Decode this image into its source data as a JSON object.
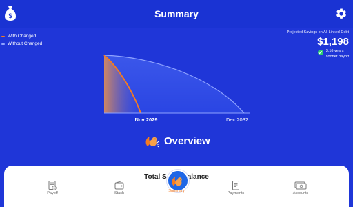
{
  "header": {
    "title": "Summary",
    "app_icon": "money-bag-icon",
    "settings_icon": "gear-icon"
  },
  "legend": [
    {
      "label": "With Changed",
      "color": "#f47b20"
    },
    {
      "label": "Without Changed",
      "color": "#8fa3ff"
    }
  ],
  "savings": {
    "label": "Projected Savings on All Linked Debt",
    "amount": "$1,198",
    "sooner_line1": "3.16 years",
    "sooner_line2": "sooner payoff"
  },
  "chart_data": {
    "type": "area",
    "series": [
      {
        "name": "With Changed",
        "end": "Nov 2029",
        "color": "#f47b20"
      },
      {
        "name": "Without Changed",
        "end": "Dec 2032",
        "color": "#8fa3ff"
      }
    ],
    "x_tick_labels": [
      "Nov 2029",
      "Dec 2032"
    ],
    "grid": false
  },
  "overview": {
    "label": "Overview",
    "icon": "squirrel-icon"
  },
  "total_balance": {
    "part1": "Total S",
    "part2": "alance"
  },
  "nav": {
    "items": [
      {
        "label": "Payoff",
        "icon": "payoff-calculator-icon"
      },
      {
        "label": "Stash",
        "icon": "wallet-icon"
      },
      {
        "label": "Summary",
        "icon": "squirrel-icon",
        "active": true
      },
      {
        "label": "Payments",
        "icon": "receipt-icon"
      },
      {
        "label": "Accounts",
        "icon": "cash-stack-icon"
      }
    ]
  },
  "colors": {
    "background": "#1f36d8",
    "accent": "#f47b20",
    "line_without": "#8fa3ff",
    "success": "#2ecc71"
  }
}
